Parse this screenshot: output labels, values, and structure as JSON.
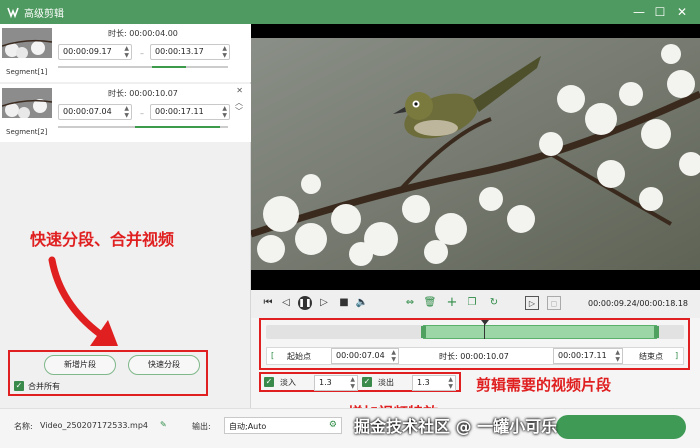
{
  "window": {
    "title": "高级剪辑"
  },
  "segments": [
    {
      "label": "Segment[1]",
      "duration": "时长: 00:00:04.00",
      "start": "00:00:09.17",
      "end": "00:00:13.17",
      "progress_fraction": [
        0.55,
        0.75
      ]
    },
    {
      "label": "Segment[2]",
      "duration": "时长: 00:00:10.07",
      "start": "00:00:07.04",
      "end": "00:00:17.11",
      "progress_fraction": [
        0.45,
        0.95
      ]
    }
  ],
  "left_buttons": {
    "add_segment": "新增片段",
    "quick_split": "快速分段",
    "merge_all": "合并所有"
  },
  "annotations": {
    "split_merge": "快速分段、合并视频",
    "clip_needed": "剪辑需要的视频片段",
    "add_effects": "增加视频特效"
  },
  "player": {
    "time": "00:00:09.24/00:00:18.18"
  },
  "range": {
    "start_label": "起始点",
    "start_value": "00:00:07.04",
    "duration": "时长: 00:00:10.07",
    "end_value": "00:00:17.11",
    "end_label": "结束点",
    "selection_fraction": [
      0.375,
      0.935
    ],
    "playhead_fraction": 0.5
  },
  "effects": {
    "fade_in_label": "淡入",
    "fade_in_value": "1.3",
    "fade_out_label": "淡出",
    "fade_out_value": "1.3"
  },
  "footer": {
    "name_label": "名称:",
    "name_value": "Video_250207172533.mp4",
    "output_label": "输出:",
    "output_value": "自动;Auto"
  },
  "watermark": "掘金技术社区 @ 一罐小可乐",
  "colors": {
    "accent": "#4f9a60",
    "annotation": "#e02020"
  }
}
